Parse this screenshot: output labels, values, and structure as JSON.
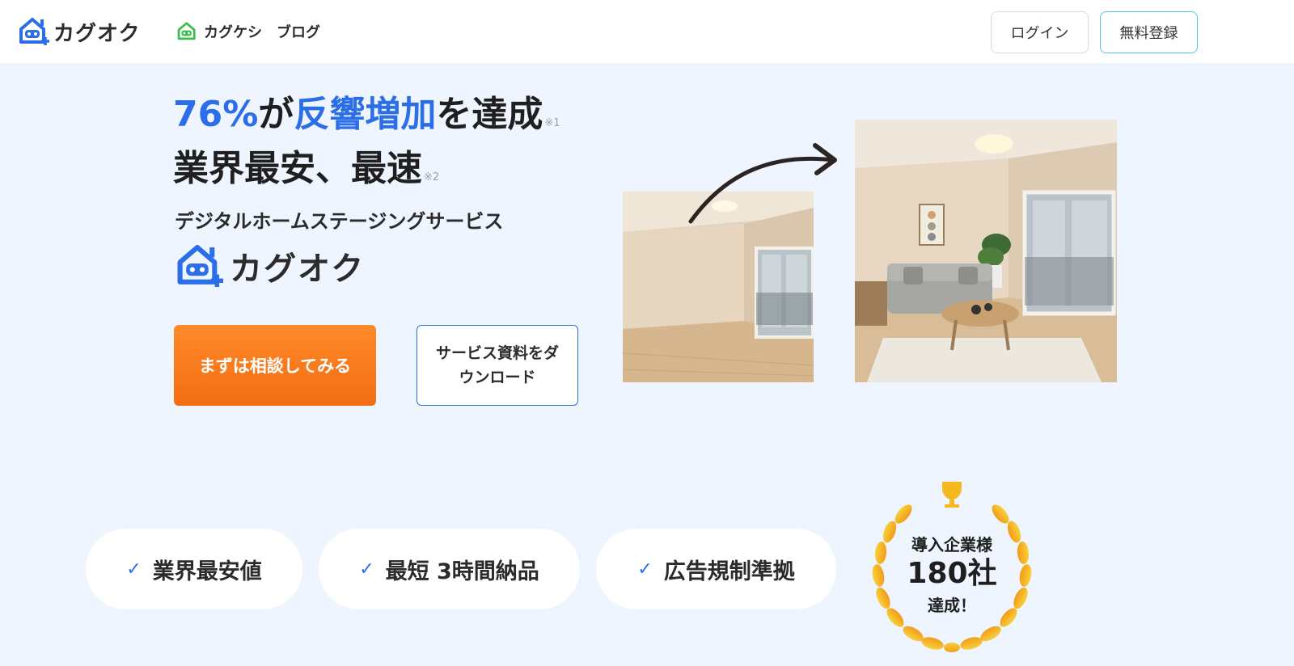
{
  "header": {
    "logo_text": "カグオク",
    "blog_brand": "カグケシ",
    "blog_label": "ブログ",
    "login_label": "ログイン",
    "signup_label": "無料登録"
  },
  "hero": {
    "headline_num": "76%",
    "headline_ga": "が",
    "headline_blue": "反響増加",
    "headline_rest": "を達成",
    "note1": "※1",
    "headline_line2": "業界最安、最速",
    "note2": "※2",
    "subtitle": "デジタルホームステージングサービス",
    "brand_text": "カグオク",
    "consult_label": "まずは相談してみる",
    "download_label": "サービス資料をダウンロード"
  },
  "features": [
    {
      "label": "業界最安値"
    },
    {
      "label": "最短 3時間納品"
    },
    {
      "label": "広告規制準拠"
    }
  ],
  "badge": {
    "line1": "導入企業様",
    "line2": "180社",
    "line3": "達成！"
  },
  "colors": {
    "accent_blue": "#2b6ee8",
    "cta_orange": "#f26d12",
    "background": "#eef5ff",
    "gold": "#f5b820"
  },
  "icons": [
    "house-robot-logo-icon",
    "check-icon",
    "arrow-icon",
    "trophy-icon",
    "laurel-wreath-icon"
  ]
}
